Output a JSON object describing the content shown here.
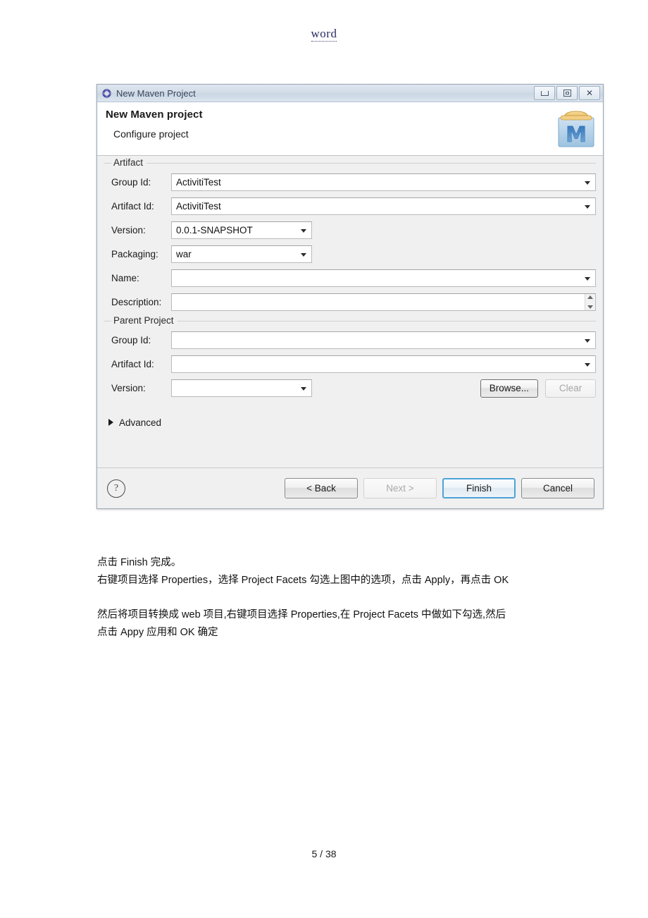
{
  "document": {
    "header_mark": "word",
    "footer_page": "5  / 38",
    "paragraphs": [
      "点击 Finish 完成。",
      "右键项目选择 Properties，选择 Project Facets  勾选上图中的选项，点击 Apply，再点击 OK",
      "然后将项目转换成 web 项目,右键项目选择 Properties,在 Project Facets 中做如下勾选,然后",
      "点击 Appy 应用和 OK 确定"
    ]
  },
  "dialog": {
    "titlebar": {
      "title": "New Maven Project",
      "app_icon": "maven-app-icon",
      "minimize_label": "",
      "maximize_label": "",
      "close_label": "✕"
    },
    "banner": {
      "heading": "New Maven project",
      "subtitle": "Configure project",
      "logo": "maven-folder-logo"
    },
    "artifact": {
      "group_label": "Artifact",
      "fields": [
        {
          "label": "Group Id:",
          "value": "ActivitiTest",
          "kind": "combo-wide"
        },
        {
          "label": "Artifact Id:",
          "value": "ActivitiTest",
          "kind": "combo-wide"
        },
        {
          "label": "Version:",
          "value": "0.0.1-SNAPSHOT",
          "kind": "combo-short"
        },
        {
          "label": "Packaging:",
          "value": "war",
          "kind": "combo-short"
        },
        {
          "label": "Name:",
          "value": "",
          "kind": "combo-wide"
        },
        {
          "label": "Description:",
          "value": "",
          "kind": "textarea"
        }
      ]
    },
    "parent": {
      "group_label": "Parent Project",
      "fields": [
        {
          "label": "Group Id:",
          "value": "",
          "kind": "combo-wide"
        },
        {
          "label": "Artifact Id:",
          "value": "",
          "kind": "combo-wide"
        },
        {
          "label": "Version:",
          "value": "",
          "kind": "combo-short"
        }
      ],
      "browse_label": "Browse...",
      "clear_label": "Clear"
    },
    "advanced": {
      "label": "Advanced",
      "expander_icon": "triangle-right-icon"
    },
    "footer": {
      "help_icon": "?",
      "back_label": "< Back",
      "next_label": "Next >",
      "finish_label": "Finish",
      "cancel_label": "Cancel"
    }
  },
  "colors": {
    "accent_focus": "#4ea3d8",
    "dialog_bg": "#f0f0f0",
    "title_text": "#39465a",
    "word_mark": "#2b2b60"
  }
}
